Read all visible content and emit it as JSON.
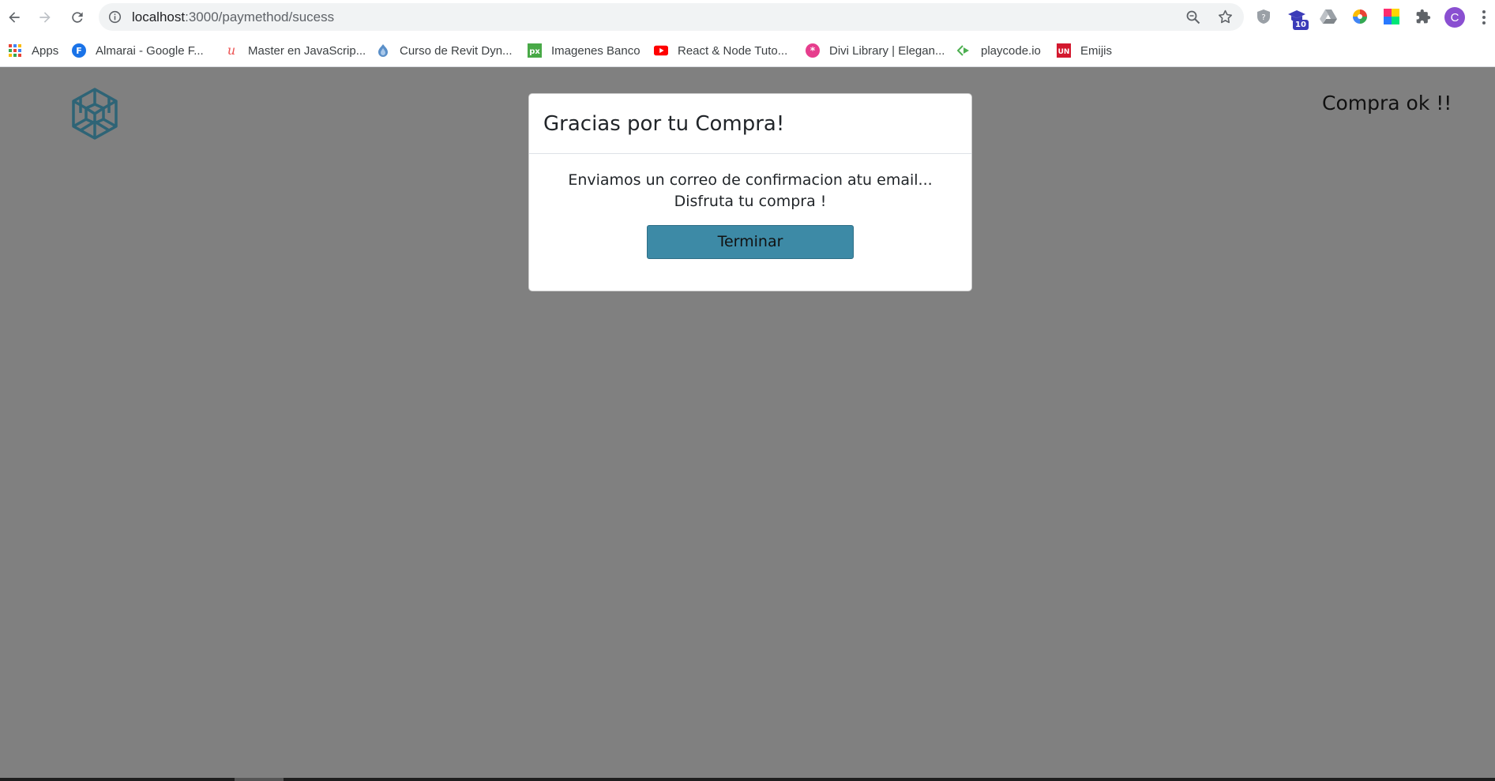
{
  "browser": {
    "url_host": "localhost",
    "url_path": ":3000/paymethod/sucess",
    "profile_initial": "C",
    "extension_badge": "10"
  },
  "bookmarks": [
    {
      "label": "Apps",
      "icon": "apps-grid-icon"
    },
    {
      "label": "Almarai - Google F...",
      "icon": "google-fonts-icon"
    },
    {
      "label": "Master en JavaScrip...",
      "icon": "udemy-icon"
    },
    {
      "label": "Curso de Revit Dyn...",
      "icon": "dynamo-icon"
    },
    {
      "label": "Imagenes Banco",
      "icon": "pixabay-icon"
    },
    {
      "label": "React & Node Tuto...",
      "icon": "youtube-icon"
    },
    {
      "label": "Divi Library | Elegan...",
      "icon": "divi-icon"
    },
    {
      "label": "playcode.io",
      "icon": "playcode-icon"
    },
    {
      "label": "Emijis",
      "icon": "unicode-icon"
    }
  ],
  "page": {
    "header_status": "Compra ok !!",
    "modal": {
      "title": "Gracias por tu Compra!",
      "message": "Enviamos un correo de confirmacion atu email... Disfruta tu compra !",
      "button_label": "Terminar"
    }
  },
  "colors": {
    "overlay": "#808080",
    "button": "#3d8aa6",
    "logo": "#2e6476"
  }
}
